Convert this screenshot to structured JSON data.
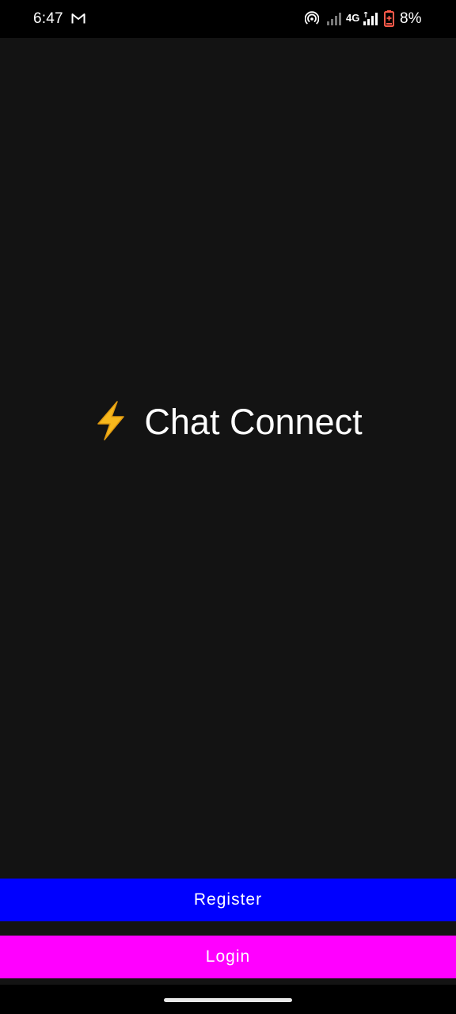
{
  "status_bar": {
    "time": "6:47",
    "network_type": "4G",
    "battery_percent": "8%",
    "icons": [
      "gmail-icon",
      "hotspot-icon",
      "signal-icon",
      "signal-icon",
      "battery-icon"
    ]
  },
  "main": {
    "title_icon": "lightning-bolt-icon",
    "title": "Chat Connect"
  },
  "actions": {
    "register_label": "Register",
    "login_label": "Login"
  },
  "colors": {
    "background": "#131313",
    "register": "#0000ff",
    "login": "#ff00ff",
    "battery_low": "#ff5a4a",
    "bolt": "#f7b81c"
  }
}
